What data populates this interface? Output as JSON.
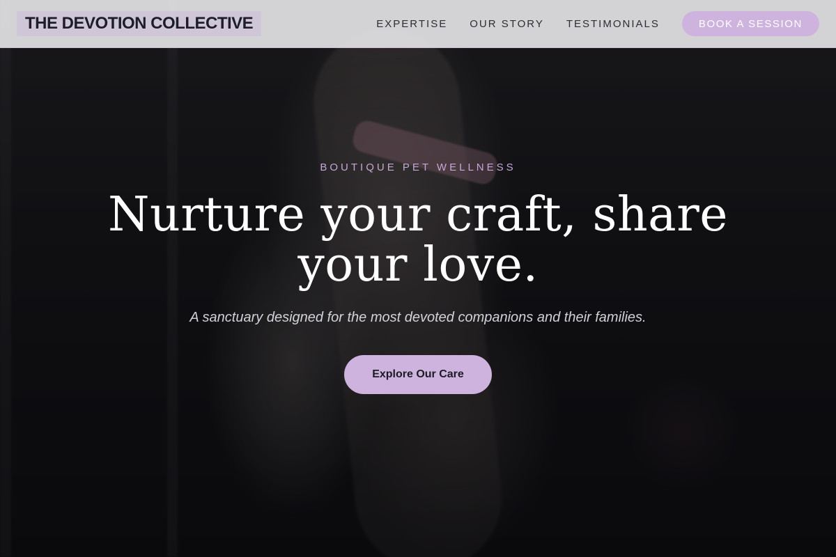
{
  "nav": {
    "brand": "THE DEVOTION COLLECTIVE",
    "links": [
      "EXPERTISE",
      "OUR STORY",
      "TESTIMONIALS"
    ],
    "cta": "BOOK A SESSION"
  },
  "hero": {
    "eyebrow": "BOUTIQUE PET WELLNESS",
    "headline": "Nurture your craft, share your love.",
    "subtitle": "A sanctuary designed for the most devoted companions and their families.",
    "button": "Explore Our Care"
  },
  "colors": {
    "accent": "#CFB3DF",
    "eyebrow": "#C7A7D6",
    "nav_bg": "#E8E8EA",
    "text_dark": "#1E1E2A",
    "hero_overlay": "#000000"
  }
}
